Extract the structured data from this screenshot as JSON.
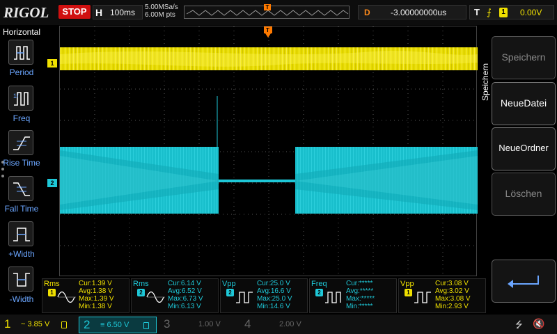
{
  "brand": "RIGOL",
  "run_state": "STOP",
  "horizontal": {
    "label": "H",
    "timebase": "100ms",
    "sample_rate": "5.00MSa/s",
    "memory_points": "6.00M pts"
  },
  "delay": {
    "label": "D",
    "value": "-3.00000000us"
  },
  "trigger": {
    "label": "T",
    "edge": "rising",
    "source": "1",
    "level": "0.00V"
  },
  "left_panel": {
    "title": "Horizontal",
    "items": [
      {
        "label": "Period",
        "icon": "period-icon"
      },
      {
        "label": "Freq",
        "icon": "freq-icon"
      },
      {
        "label": "Rise Time",
        "icon": "rise-time-icon"
      },
      {
        "label": "Fall Time",
        "icon": "fall-time-icon"
      },
      {
        "label": "+Width",
        "icon": "positive-width-icon"
      },
      {
        "label": "-Width",
        "icon": "negative-width-icon"
      }
    ]
  },
  "right_menu": {
    "title": "Speichern",
    "buttons": [
      {
        "label": "Speichern",
        "enabled": false
      },
      {
        "label": "NeueDatei",
        "enabled": true
      },
      {
        "label": "NeueOrdner",
        "enabled": true
      },
      {
        "label": "Löschen",
        "enabled": false
      }
    ],
    "enter_icon": "enter-icon"
  },
  "channel_markers": {
    "ch1": "1",
    "ch2": "2"
  },
  "measurements": [
    {
      "type": "Rms",
      "channel": "1",
      "cur": "Cur:1.39 V",
      "avg": "Avg:1.38 V",
      "max": "Max:1.39 V",
      "min": "Min:1.38 V"
    },
    {
      "type": "Rms",
      "channel": "2",
      "cur": "Cur:6.14 V",
      "avg": "Avg:6.52 V",
      "max": "Max:6.73 V",
      "min": "Min:6.13 V"
    },
    {
      "type": "Vpp",
      "channel": "2",
      "cur": "Cur:25.0 V",
      "avg": "Avg:16.6 V",
      "max": "Max:25.0 V",
      "min": "Min:14.6 V"
    },
    {
      "type": "Freq",
      "channel": "2",
      "cur": "Cur:*****",
      "avg": "Avg:*****",
      "max": "Max:*****",
      "min": "Min:*****"
    },
    {
      "type": "Vpp",
      "channel": "1",
      "cur": "Cur:3.08 V",
      "avg": "Avg:3.02 V",
      "max": "Max:3.08 V",
      "min": "Min:2.93 V"
    }
  ],
  "channels_bar": [
    {
      "num": "1",
      "scale": "~ 3.85 V"
    },
    {
      "num": "2",
      "scale": "≡ 6.50 V"
    },
    {
      "num": "3",
      "scale": "1.00 V"
    },
    {
      "num": "4",
      "scale": "2.00 V"
    }
  ],
  "colors": {
    "ch1": "#f0e000",
    "ch2": "#1ec8d8",
    "stop": "#d01010",
    "delay": "#ff8a1a",
    "trigger": "#ff7a00"
  }
}
